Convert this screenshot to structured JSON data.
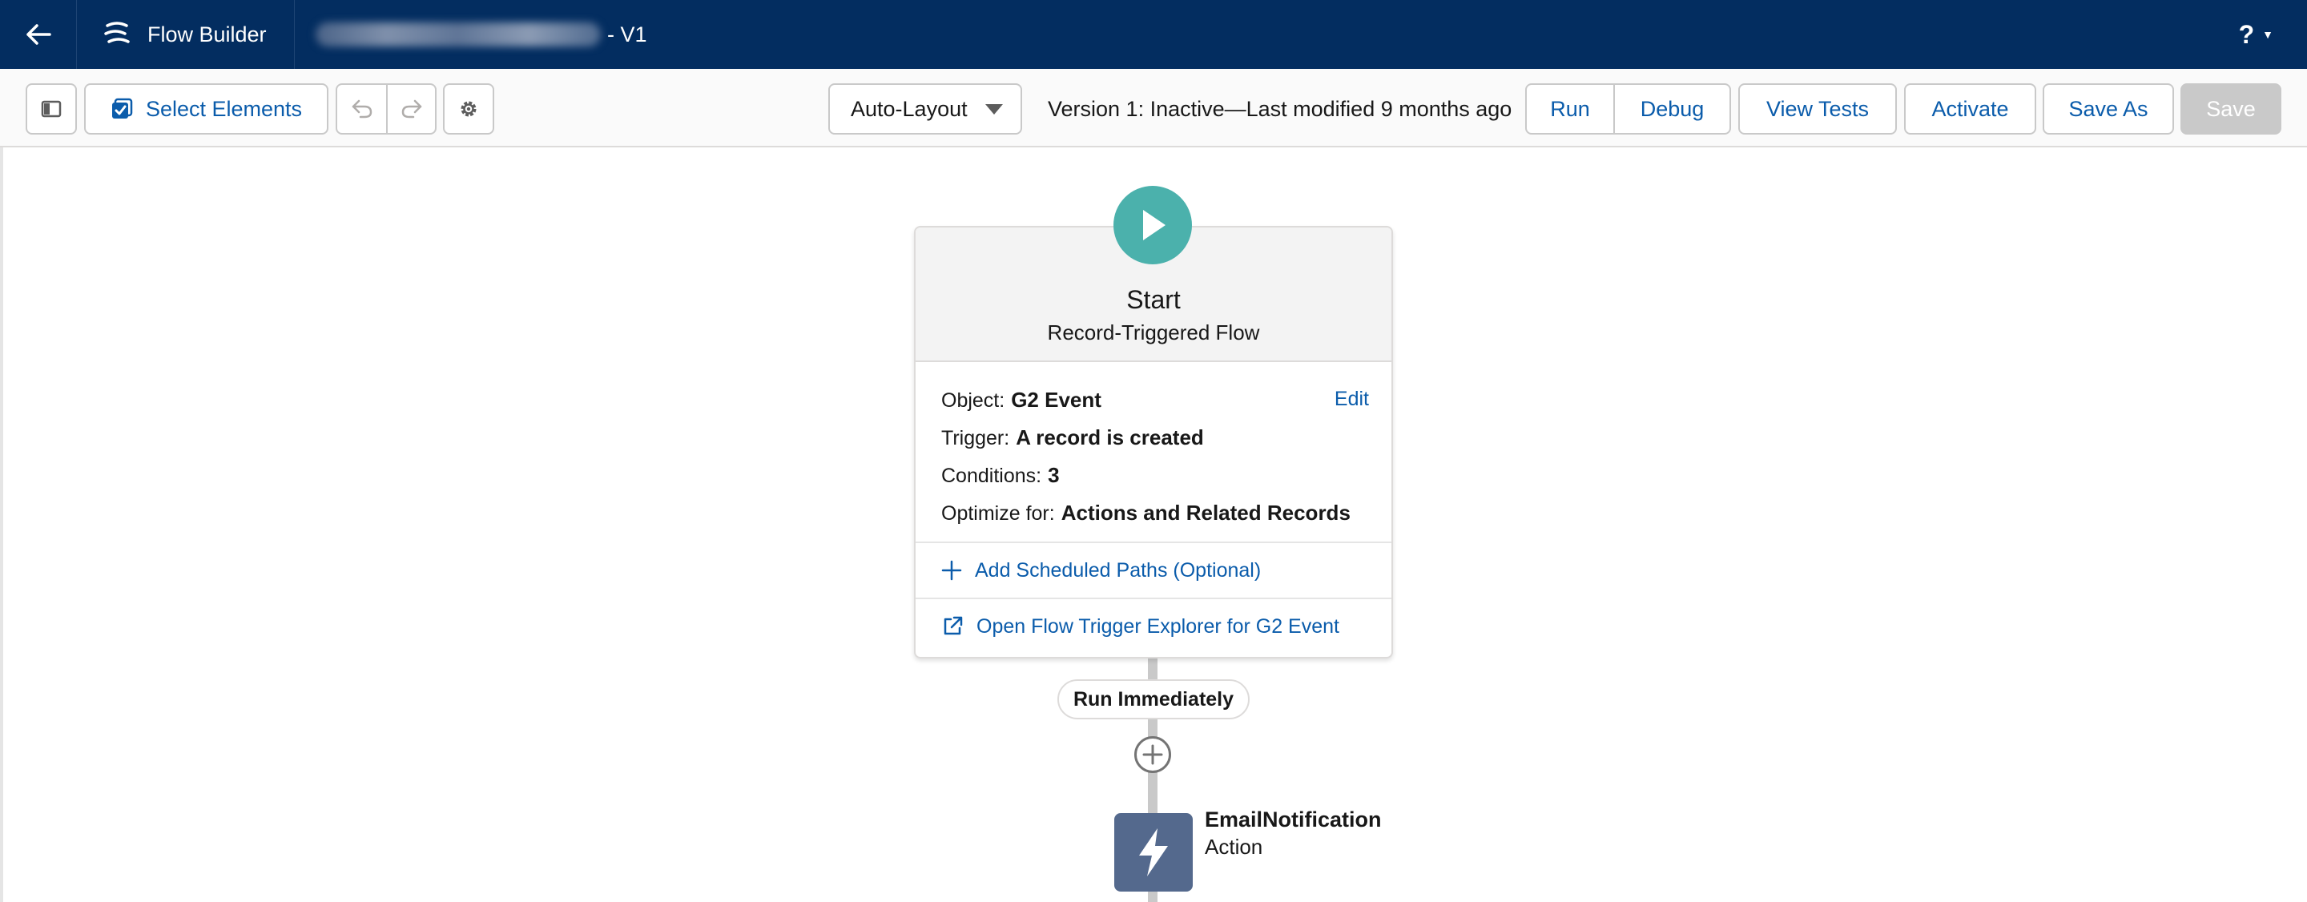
{
  "header": {
    "app_name": "Flow Builder",
    "flow_version_suffix": "- V1",
    "help_label": "?"
  },
  "toolbar": {
    "select_elements_label": "Select Elements",
    "layout_mode": "Auto-Layout",
    "version_status": "Version 1: Inactive—Last modified 9 months ago",
    "run_label": "Run",
    "debug_label": "Debug",
    "view_tests_label": "View Tests",
    "activate_label": "Activate",
    "save_as_label": "Save As",
    "save_label": "Save"
  },
  "start": {
    "title": "Start",
    "subtitle": "Record-Triggered Flow",
    "edit_label": "Edit",
    "object_label": "Object:",
    "object_value": "G2 Event",
    "trigger_label": "Trigger:",
    "trigger_value": "A record is created",
    "conditions_label": "Conditions:",
    "conditions_value": "3",
    "optimize_label": "Optimize for:",
    "optimize_value": "Actions and Related Records",
    "add_paths_label": "Add Scheduled Paths (Optional)",
    "explorer_label": "Open Flow Trigger Explorer for G2 Event"
  },
  "path": {
    "run_label": "Run Immediately"
  },
  "action": {
    "name": "EmailNotification",
    "type": "Action"
  },
  "colors": {
    "header_bg": "#032d60",
    "link": "#0b5cab",
    "start_icon": "#4bb1ac",
    "action_icon": "#54698d",
    "connector": "#c9c9c9"
  }
}
